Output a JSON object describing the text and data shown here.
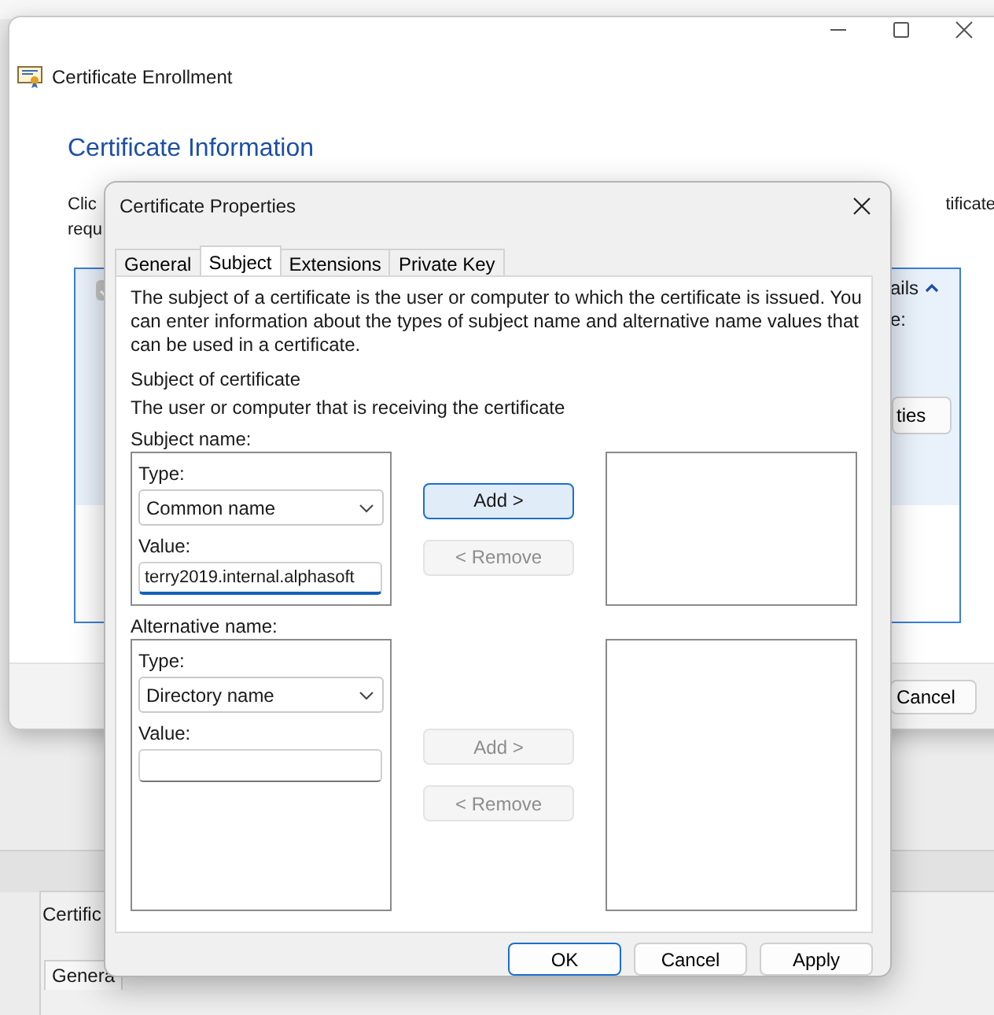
{
  "lower_window": {
    "title": "Certific",
    "tab": "Genera"
  },
  "back_window": {
    "title": "Certificate Enrollment",
    "heading": "Certificate Information",
    "intro_left": [
      "Clic",
      "requ"
    ],
    "intro_right": "tificate",
    "checkbox": {
      "checked": true,
      "disabled": true
    },
    "details_toggle": "ails",
    "details_label": "e:",
    "properties_button": "ties",
    "cancel_button": "Cancel"
  },
  "dialog": {
    "title": "Certificate Properties",
    "tabs": [
      {
        "label": "General",
        "selected": false
      },
      {
        "label": "Subject",
        "selected": true
      },
      {
        "label": "Extensions",
        "selected": false
      },
      {
        "label": "Private Key",
        "selected": false
      }
    ],
    "description": "The subject of a certificate is the user or computer to which the certificate is issued. You can enter information about the types of subject name and alternative name values that can be used in a certificate.",
    "section_title": "Subject of certificate",
    "section_hint": "The user or computer that is receiving the certificate",
    "groups": [
      {
        "label": "Subject name:",
        "type_field": {
          "label": "Type:",
          "selected_option": "Common name"
        },
        "value_field": {
          "label": "Value:",
          "text": "terry2019.internal.alphasoft",
          "focused": true
        },
        "add": {
          "label": "Add >",
          "disabled": false,
          "focused": true
        },
        "remove": {
          "label": "< Remove",
          "disabled": true
        }
      },
      {
        "label": "Alternative name:",
        "type_field": {
          "label": "Type:",
          "selected_option": "Directory name"
        },
        "value_field": {
          "label": "Value:",
          "focused": false
        },
        "add": {
          "label": "Add >",
          "disabled": true,
          "focused": false
        },
        "remove": {
          "label": "< Remove",
          "disabled": true
        }
      }
    ],
    "buttons": [
      {
        "label": "OK",
        "default": true
      },
      {
        "label": "Cancel",
        "default": false
      },
      {
        "label": "Apply",
        "default": false
      }
    ]
  }
}
